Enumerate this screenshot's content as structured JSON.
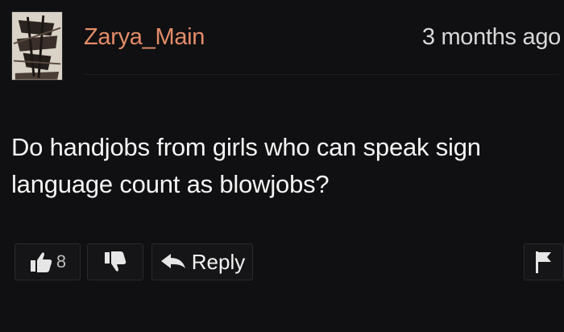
{
  "comment": {
    "username": "Zarya_Main",
    "timestamp": "3 months ago",
    "text": "Do handjobs from girls who can speak sign language count as blowjobs?",
    "likes": "8",
    "reply_label": "Reply"
  },
  "icons": {
    "avatar": "avatar-image",
    "like": "thumbs-up-icon",
    "dislike": "thumbs-down-icon",
    "reply": "reply-arrow-icon",
    "report": "flag-icon"
  },
  "colors": {
    "background": "#101012",
    "username": "#e48c6a",
    "text": "#f4f4f4",
    "button_bg": "#151517",
    "button_border": "#2a2a2e"
  }
}
